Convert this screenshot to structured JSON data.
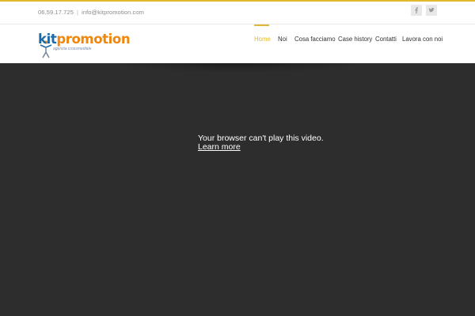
{
  "topbar": {
    "phone": "06.59.17.725",
    "separator": "|",
    "email": "info@kitpromotion.com"
  },
  "social": [
    {
      "icon": "facebook-icon",
      "glyph": "f"
    },
    {
      "icon": "twitter-icon",
      "glyph": "t"
    }
  ],
  "logo": {
    "part1": "kit",
    "part2": "promotion",
    "tagline": "agenzia crossmediale",
    "colors": {
      "kit": "#1e6aa7",
      "promotion": "#f0860c"
    }
  },
  "nav": {
    "items": [
      {
        "label": "Home",
        "active": true
      },
      {
        "label": "Noi",
        "active": false
      },
      {
        "label": "Cosa facciamo",
        "active": false
      },
      {
        "label": "Case history",
        "active": false
      },
      {
        "label": "Contatti",
        "active": false
      },
      {
        "label": "Lavora con noi",
        "active": false
      }
    ]
  },
  "video": {
    "message": "Your browser can't play this video.",
    "link": "Learn more"
  },
  "colors": {
    "accent": "#e3b82f",
    "video_bg": "#2d2d2d"
  }
}
